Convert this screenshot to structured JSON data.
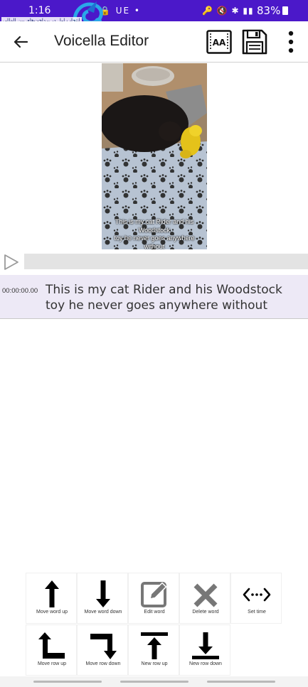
{
  "status_bar": {
    "time": "1:16",
    "left_icons": "🔒 UE •",
    "right_icons": "🔑 🔇 ✱ ▮▮",
    "battery": "83%"
  },
  "watermark": {
    "text": "انتخاب اول در پرداخت‌های بین المللی"
  },
  "app_bar": {
    "title": "Voicella Editor",
    "captions_icon_label": "AA"
  },
  "video": {
    "caption_lines": [
      "This is my cat Rider and his",
      "Woodstock",
      "toy he never goes anywhere",
      "without"
    ]
  },
  "subtitle": {
    "timestamp": "00:00:00.00",
    "text": "This is my cat Rider and his Woodstock toy he never goes anywhere without"
  },
  "tools": [
    {
      "label": "Move word up",
      "icon": "arrow-up-icon"
    },
    {
      "label": "Move word down",
      "icon": "arrow-down-icon"
    },
    {
      "label": "Edit word",
      "icon": "edit-icon"
    },
    {
      "label": "Delete word",
      "icon": "close-icon"
    },
    {
      "label": "Set time",
      "icon": "code-dots-icon"
    },
    {
      "label": "Move row up",
      "icon": "turn-up-left-icon"
    },
    {
      "label": "Move row down",
      "icon": "turn-down-right-icon"
    },
    {
      "label": "New row up",
      "icon": "align-top-arrow-icon"
    },
    {
      "label": "New row down",
      "icon": "align-bottom-arrow-icon"
    }
  ],
  "colors": {
    "status_bar": "#4b18c9",
    "subtitle_highlight": "#ede9f6",
    "seekbar": "#e3e3e3"
  }
}
